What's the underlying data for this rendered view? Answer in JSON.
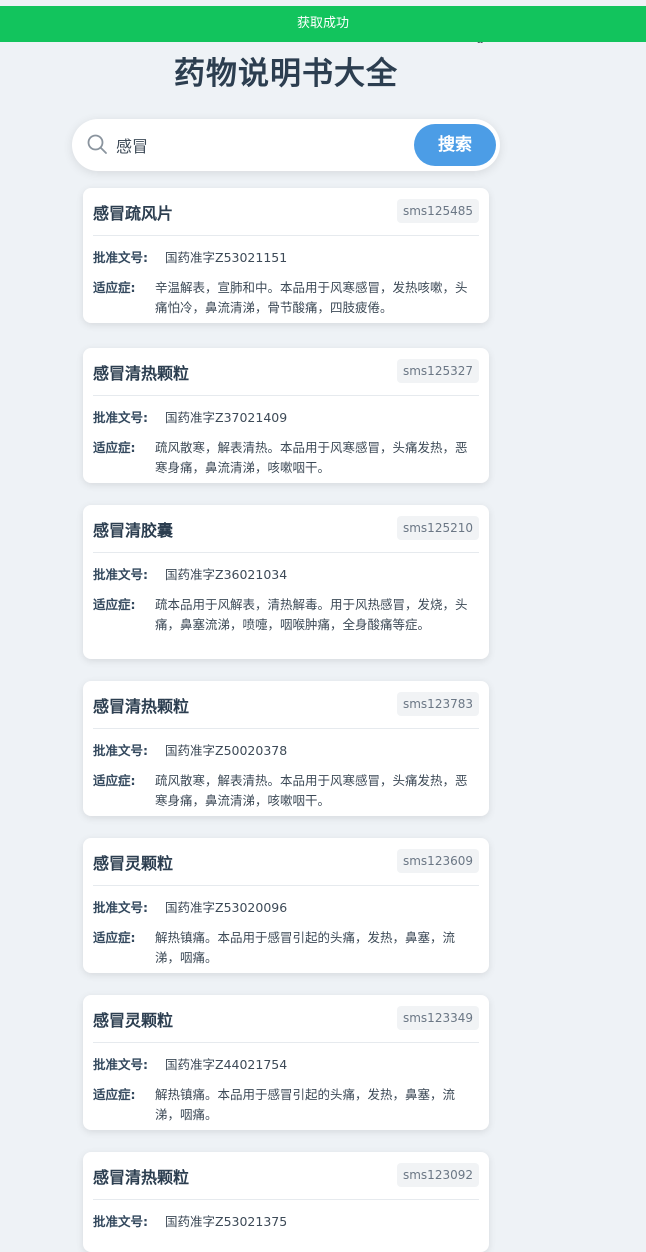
{
  "toast": {
    "text": "获取成功"
  },
  "page": {
    "title": "药物说明书大全"
  },
  "search": {
    "value": "感冒",
    "button_label": "搜索"
  },
  "labels": {
    "approval": "批准文号:",
    "indication": "适应症:"
  },
  "results": [
    {
      "name": "感冒疏风片",
      "id": "sms125485",
      "approval": "国药准字Z53021151",
      "indication": "辛温解表，宣肺和中。本品用于风寒感冒，发热咳嗽，头痛怕冷，鼻流清涕，骨节酸痛，四肢疲倦。"
    },
    {
      "name": "感冒清热颗粒",
      "id": "sms125327",
      "approval": "国药准字Z37021409",
      "indication": "疏风散寒，解表清热。本品用于风寒感冒，头痛发热，恶寒身痛，鼻流清涕，咳嗽咽干。"
    },
    {
      "name": "感冒清胶囊",
      "id": "sms125210",
      "approval": "国药准字Z36021034",
      "indication": "疏本品用于风解表，清热解毒。用于风热感冒，发烧，头痛，鼻塞流涕，喷嚏，咽喉肿痛，全身酸痛等症。"
    },
    {
      "name": "感冒清热颗粒",
      "id": "sms123783",
      "approval": "国药准字Z50020378",
      "indication": "疏风散寒，解表清热。本品用于风寒感冒，头痛发热，恶寒身痛，鼻流清涕，咳嗽咽干。"
    },
    {
      "name": "感冒灵颗粒",
      "id": "sms123609",
      "approval": "国药准字Z53020096",
      "indication": "解热镇痛。本品用于感冒引起的头痛，发热，鼻塞，流涕，咽痛。"
    },
    {
      "name": "感冒灵颗粒",
      "id": "sms123349",
      "approval": "国药准字Z44021754",
      "indication": "解热镇痛。本品用于感冒引起的头痛，发热，鼻塞，流涕，咽痛。"
    },
    {
      "name": "感冒清热颗粒",
      "id": "sms123092",
      "approval": "国药准字Z53021375",
      "indication": ""
    }
  ]
}
